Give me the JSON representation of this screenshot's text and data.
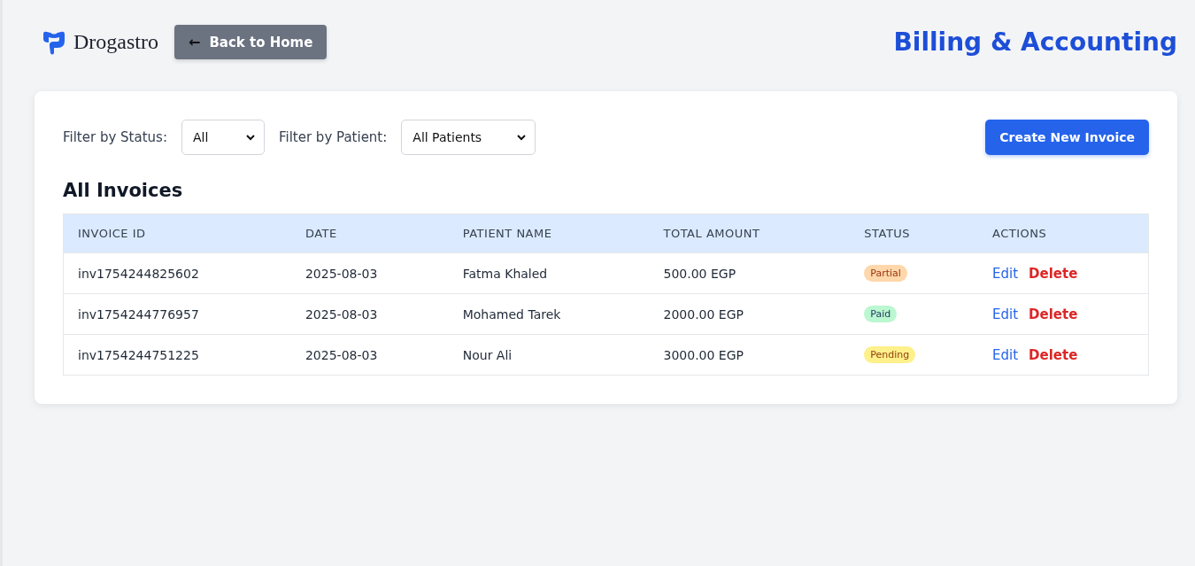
{
  "header": {
    "logo_text": "Drogastro",
    "back_button": {
      "arrow": "←",
      "label": "Back to Home"
    },
    "title": "Billing & Accounting"
  },
  "filters": [
    {
      "label": "Filter by Status:",
      "value": "All"
    },
    {
      "label": "Filter by Patient:",
      "value": "All Patients"
    }
  ],
  "create_button": "Create New Invoice",
  "section_title": "All Invoices",
  "table": {
    "columns": [
      "INVOICE ID",
      "DATE",
      "PATIENT NAME",
      "TOTAL AMOUNT",
      "STATUS",
      "ACTIONS"
    ],
    "rows": [
      {
        "id": "inv1754244825602",
        "date": "2025-08-03",
        "patient": "Fatma Khaled",
        "amount": "500.00 EGP",
        "status": {
          "label": "Partial",
          "kind": "partial"
        },
        "actions": [
          "Edit",
          "Delete"
        ]
      },
      {
        "id": "inv1754244776957",
        "date": "2025-08-03",
        "patient": "Mohamed Tarek",
        "amount": "2000.00 EGP",
        "status": {
          "label": "Paid",
          "kind": "paid"
        },
        "actions": [
          "Edit",
          "Delete"
        ]
      },
      {
        "id": "inv1754244751225",
        "date": "2025-08-03",
        "patient": "Nour Ali",
        "amount": "3000.00 EGP",
        "status": {
          "label": "Pending",
          "kind": "pending"
        },
        "actions": [
          "Edit",
          "Delete"
        ]
      }
    ]
  }
}
